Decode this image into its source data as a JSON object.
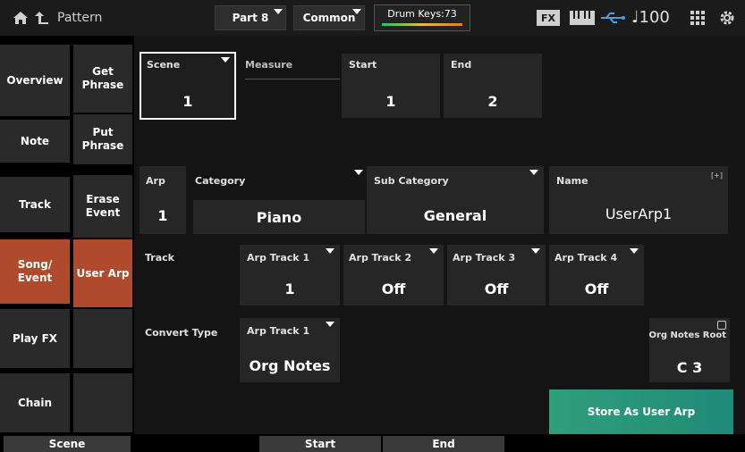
{
  "topbar": {
    "title": "Pattern",
    "part_button": "Part 8",
    "common_button": "Common",
    "drum_keys": "Drum Keys:73",
    "fx_badge": "FX",
    "tempo": "♩100"
  },
  "left_tabs": [
    "Overview",
    "Note",
    "Track",
    "Song/\nEvent",
    "Play FX",
    "Chain"
  ],
  "sub_tabs": [
    "Get\nPhrase",
    "Put\nPhrase",
    "Erase\nEvent",
    "User Arp"
  ],
  "scene": {
    "label": "Scene",
    "value": "1"
  },
  "measure": {
    "label": "Measure",
    "start_label": "Start",
    "start_value": "1",
    "end_label": "End",
    "end_value": "2"
  },
  "arp_row": {
    "arp_label": "Arp",
    "arp_value": "1",
    "category_label": "Category",
    "category_value": "Piano",
    "subcategory_label": "Sub Category",
    "subcategory_value": "General",
    "name_label": "Name",
    "name_value": "UserArp1",
    "name_tag": "[+]"
  },
  "track_row": {
    "label": "Track",
    "tracks": [
      {
        "label": "Arp Track 1",
        "value": "1"
      },
      {
        "label": "Arp Track 2",
        "value": "Off"
      },
      {
        "label": "Arp Track 3",
        "value": "Off"
      },
      {
        "label": "Arp Track 4",
        "value": "Off"
      }
    ]
  },
  "convert_row": {
    "label": "Convert Type",
    "track_label": "Arp Track 1",
    "track_value": "Org Notes",
    "root_label": "Org Notes Root",
    "root_value": "C 3"
  },
  "store_button": "Store As User Arp",
  "bottom_bar": {
    "scene": "Scene",
    "start": "Start",
    "end": "End"
  },
  "colors": {
    "accent_orange": "#b04a2c",
    "store_green": "#2a9a78"
  }
}
